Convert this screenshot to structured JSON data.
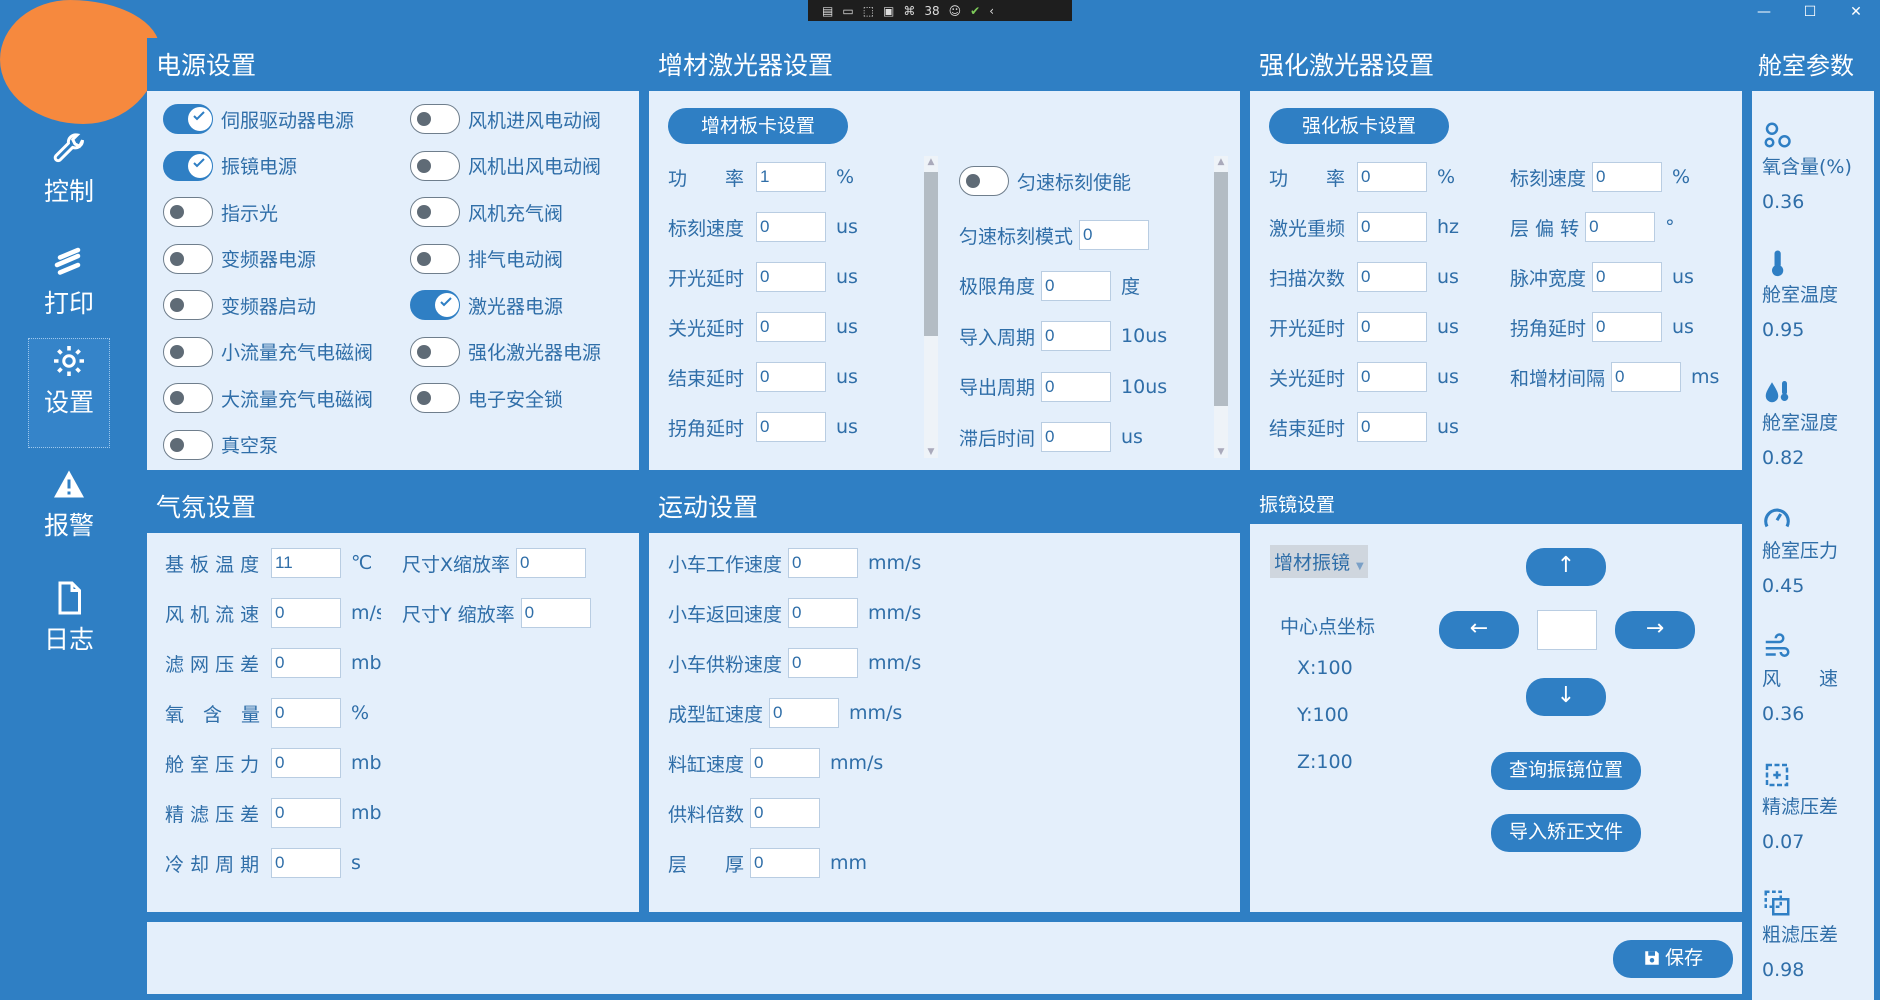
{
  "debug_toolbar": {
    "count": "38"
  },
  "window": {
    "minimize": "—",
    "maximize": "☐",
    "close": "✕"
  },
  "nav": [
    {
      "label": "控制",
      "icon": "wrench-icon"
    },
    {
      "label": "打印",
      "icon": "print-icon"
    },
    {
      "label": "设置",
      "icon": "gear-icon",
      "active": true
    },
    {
      "label": "报警",
      "icon": "warning-icon"
    },
    {
      "label": "日志",
      "icon": "document-icon"
    }
  ],
  "power": {
    "title": "电源设置",
    "left": [
      {
        "label": "伺服驱动器电源",
        "on": true
      },
      {
        "label": "振镜电源",
        "on": true
      },
      {
        "label": "指示光",
        "on": false
      },
      {
        "label": "变频器电源",
        "on": false
      },
      {
        "label": "变频器启动",
        "on": false
      },
      {
        "label": "小流量充气电磁阀",
        "on": false
      },
      {
        "label": "大流量充气电磁阀",
        "on": false
      },
      {
        "label": "真空泵",
        "on": false
      }
    ],
    "right": [
      {
        "label": "风机进风电动阀",
        "on": false
      },
      {
        "label": "风机出风电动阀",
        "on": false
      },
      {
        "label": "风机充气阀",
        "on": false
      },
      {
        "label": "排气电动阀",
        "on": false
      },
      {
        "label": "激光器电源",
        "on": true
      },
      {
        "label": "强化激光器电源",
        "on": false
      },
      {
        "label": "电子安全锁",
        "on": false
      }
    ]
  },
  "additive_laser": {
    "title": "增材激光器设置",
    "card_button": "增材板卡设置",
    "left": [
      {
        "label": "功　　率",
        "value": "1",
        "unit": "%"
      },
      {
        "label": "标刻速度",
        "value": "0",
        "unit": "us"
      },
      {
        "label": "开光延时",
        "value": "0",
        "unit": "us"
      },
      {
        "label": "关光延时",
        "value": "0",
        "unit": "us"
      },
      {
        "label": "结束延时",
        "value": "0",
        "unit": "us"
      },
      {
        "label": "拐角延时",
        "value": "0",
        "unit": "us"
      }
    ],
    "uniform_toggle": "匀速标刻使能",
    "right": [
      {
        "label": "匀速标刻模式",
        "value": "0",
        "unit": ""
      },
      {
        "label": "极限角度",
        "value": "0",
        "unit": "度"
      },
      {
        "label": "导入周期",
        "value": "0",
        "unit": "10us"
      },
      {
        "label": "导出周期",
        "value": "0",
        "unit": "10us"
      },
      {
        "label": "滞后时间",
        "value": "0",
        "unit": "us"
      }
    ]
  },
  "enhance_laser": {
    "title": "强化激光器设置",
    "card_button": "强化板卡设置",
    "left": [
      {
        "label": "功　　率",
        "value": "0",
        "unit": "%"
      },
      {
        "label": "激光重频",
        "value": "0",
        "unit": "hz"
      },
      {
        "label": "扫描次数",
        "value": "0",
        "unit": "us"
      },
      {
        "label": "开光延时",
        "value": "0",
        "unit": "us"
      },
      {
        "label": "关光延时",
        "value": "0",
        "unit": "us"
      },
      {
        "label": "结束延时",
        "value": "0",
        "unit": "us"
      }
    ],
    "right": [
      {
        "label": "标刻速度",
        "value": "0",
        "unit": "%"
      },
      {
        "label": "层 偏 转",
        "value": "0",
        "unit": "°"
      },
      {
        "label": "脉冲宽度",
        "value": "0",
        "unit": "us"
      },
      {
        "label": "拐角延时",
        "value": "0",
        "unit": "us"
      },
      {
        "label": "和增材间隔",
        "value": "0",
        "unit": "ms"
      }
    ]
  },
  "chamber": {
    "title": "舱室参数",
    "items": [
      {
        "label": "氧含量(%)",
        "value": "0.36",
        "icon": "oxygen-icon"
      },
      {
        "label": "舱室温度",
        "value": "0.95",
        "icon": "thermometer-icon"
      },
      {
        "label": "舱室湿度",
        "value": "0.82",
        "icon": "humidity-icon"
      },
      {
        "label": "舱室压力",
        "value": "0.45",
        "icon": "pressure-gauge-icon"
      },
      {
        "label": "风　　速",
        "value": "0.36",
        "icon": "wind-icon"
      },
      {
        "label": "精滤压差",
        "value": "0.07",
        "icon": "fine-filter-icon"
      },
      {
        "label": "粗滤压差",
        "value": "0.98",
        "icon": "coarse-filter-icon"
      }
    ]
  },
  "atmosphere": {
    "title": "气氛设置",
    "left": [
      {
        "label": "基 板 温 度",
        "value": "11",
        "unit": "℃"
      },
      {
        "label": "风 机 流 速",
        "value": "0",
        "unit": "m/s"
      },
      {
        "label": "滤 网 压 差",
        "value": "0",
        "unit": "mbar"
      },
      {
        "label": "氧　含　量",
        "value": "0",
        "unit": "%"
      },
      {
        "label": "舱 室 压 力",
        "value": "0",
        "unit": "mbar"
      },
      {
        "label": "精 滤 压 差",
        "value": "0",
        "unit": "mbar"
      },
      {
        "label": "冷 却 周 期",
        "value": "0",
        "unit": "s"
      }
    ],
    "right": [
      {
        "label": "尺寸X缩放率",
        "value": "0"
      },
      {
        "label": "尺寸Y 缩放率",
        "value": "0"
      }
    ]
  },
  "motion": {
    "title": "运动设置",
    "items": [
      {
        "label": "小车工作速度",
        "value": "0",
        "unit": "mm/s"
      },
      {
        "label": "小车返回速度",
        "value": "0",
        "unit": "mm/s"
      },
      {
        "label": "小车供粉速度",
        "value": "0",
        "unit": "mm/s"
      },
      {
        "label": "成型缸速度",
        "value": "0",
        "unit": "mm/s"
      },
      {
        "label": "料缸速度",
        "value": "0",
        "unit": "mm/s"
      },
      {
        "label": "供料倍数",
        "value": "0",
        "unit": ""
      },
      {
        "label": "层　　厚",
        "value": "0",
        "unit": "mm"
      }
    ]
  },
  "galvo": {
    "title": "振镜设置",
    "selected": "增材振镜",
    "center_label": "中心点坐标",
    "x": "X:100",
    "y": "Y:100",
    "z": "Z:100",
    "up": "↑",
    "down": "↓",
    "left": "←",
    "right": "→",
    "step_value": "",
    "query_button": "查询振镜位置",
    "import_button": "导入矫正文件"
  },
  "save_button": "保存",
  "colors": {
    "primary": "#2f7fc4",
    "panel": "#e4effb",
    "text": "#2f6ea8",
    "blob": "#f6893e"
  }
}
